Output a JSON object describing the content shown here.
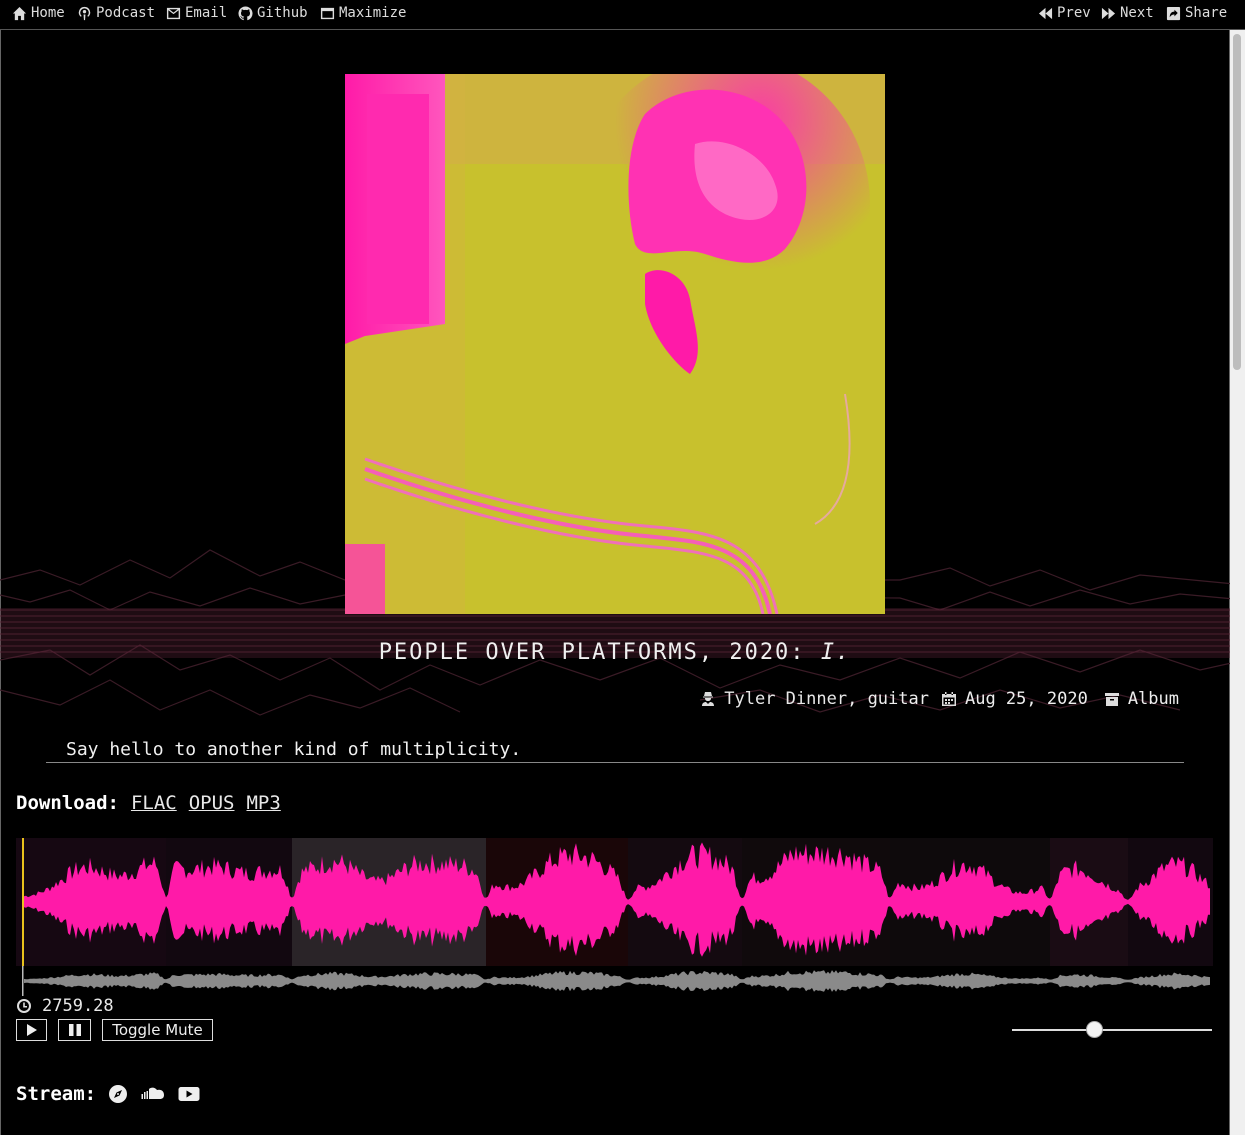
{
  "nav": {
    "home": "Home",
    "podcast": "Podcast",
    "email": "Email",
    "github": "Github",
    "maximize": "Maximize",
    "prev": "Prev",
    "next": "Next",
    "share": "Share"
  },
  "release": {
    "title_prefix": "PEOPLE OVER PLATFORMS, 2020:",
    "title_suffix": "I.",
    "artist": "Tyler Dinner",
    "role": ", guitar",
    "date": "Aug 25, 2020",
    "type": "Album",
    "description": "Say hello to another kind of multiplicity."
  },
  "download": {
    "label": "Download:",
    "formats": [
      "FLAC",
      "OPUS",
      "MP3"
    ]
  },
  "player": {
    "time": "2759.28",
    "toggle_mute": "Toggle Mute",
    "volume": 0.41
  },
  "stream": {
    "label": "Stream:"
  },
  "colors": {
    "waveform": "#ff1aa8",
    "cover_bg": "#c8c12d",
    "cover_accent": "#ff2fb0",
    "playhead": "#e9c21c"
  }
}
